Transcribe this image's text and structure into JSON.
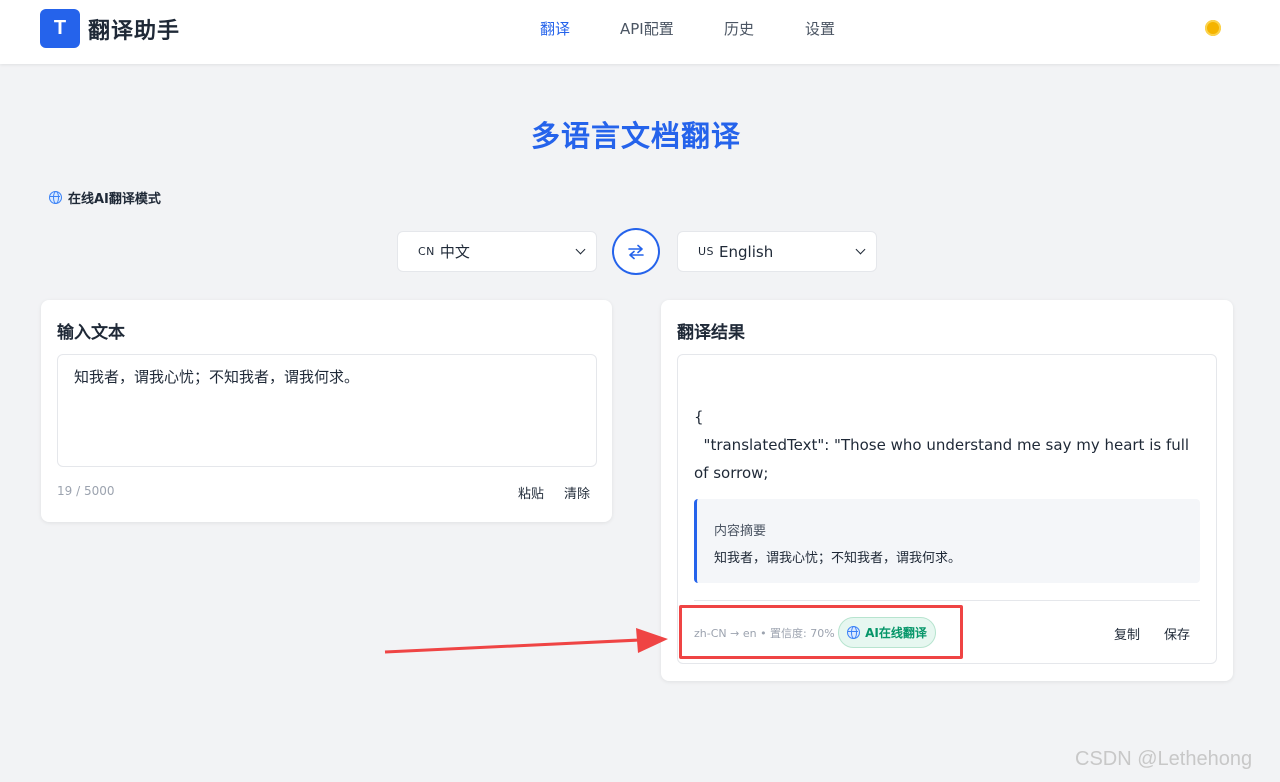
{
  "app": {
    "logo_letter": "T",
    "title": "翻译助手"
  },
  "nav": {
    "items": [
      "翻译",
      "API配置",
      "历史",
      "设置"
    ],
    "active_index": 0
  },
  "page": {
    "title": "多语言文档翻译",
    "mode_label": "在线AI翻译模式"
  },
  "languages": {
    "source": {
      "flag": "CN",
      "label": "中文"
    },
    "target": {
      "flag": "US",
      "label": "English"
    }
  },
  "input": {
    "title": "输入文本",
    "text": "知我者，谓我心忧；不知我者，谓我何求。",
    "char_count": "19 / 5000",
    "paste_label": "粘贴",
    "clear_label": "清除"
  },
  "result": {
    "title": "翻译结果",
    "text": "{\n  \"translatedText\": \"Those who understand me say my heart is full of sorrow;",
    "summary_label": "内容摘要",
    "summary_text": "知我者，谓我心忧；不知我者，谓我何求。",
    "meta": "zh-CN → en • 置信度: 70%",
    "badge": "AI在线翻译",
    "copy_label": "复制",
    "save_label": "保存"
  },
  "watermark": "CSDN @Lethehong",
  "colors": {
    "accent": "#2563eb",
    "annotation": "#ef4444",
    "badge": "#059669"
  },
  "icons": [
    "sun-icon",
    "globe-icon",
    "swap-icon",
    "chevron-down-icon"
  ]
}
